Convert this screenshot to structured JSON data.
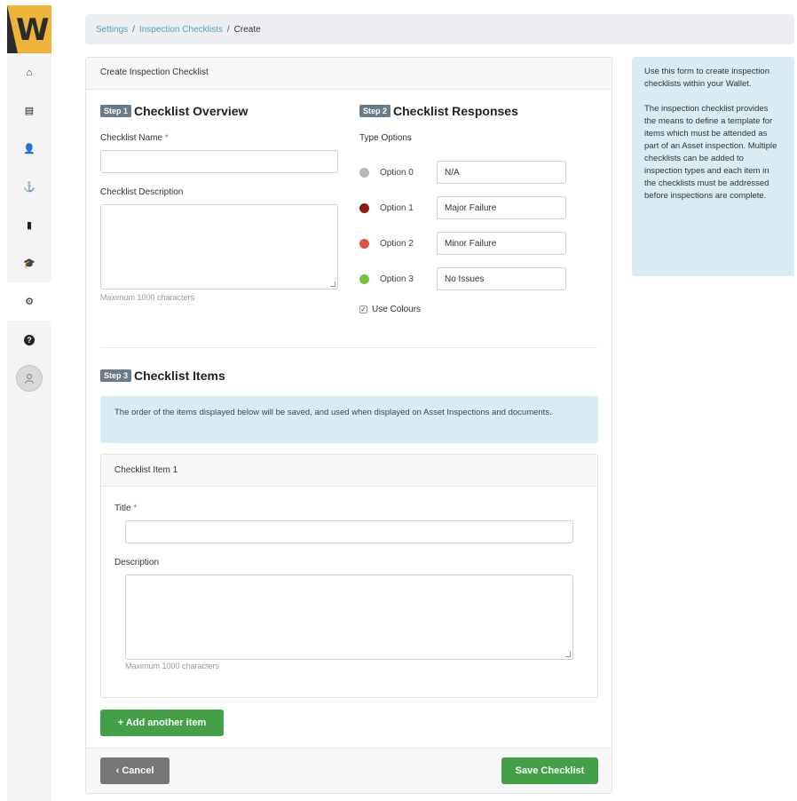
{
  "app": {
    "logo_text": "W"
  },
  "sidebar": {
    "items": [
      {
        "name": "home",
        "icon": "home-icon",
        "glyph": "⌂"
      },
      {
        "name": "documents",
        "icon": "document-icon",
        "glyph": "▤"
      },
      {
        "name": "people",
        "icon": "user-icon",
        "glyph": "👤"
      },
      {
        "name": "assets",
        "icon": "anchor-icon",
        "glyph": "⚓"
      },
      {
        "name": "checklists",
        "icon": "clipboard-icon",
        "glyph": "▮"
      },
      {
        "name": "training",
        "icon": "graduation-cap-icon",
        "glyph": "🎓"
      },
      {
        "name": "settings",
        "icon": "gear-icon",
        "glyph": "⚙"
      },
      {
        "name": "help",
        "icon": "question-icon",
        "glyph": "?"
      }
    ],
    "avatar_icon": "user-avatar-icon"
  },
  "breadcrumb": {
    "items": [
      "Settings",
      "Inspection Checklists"
    ],
    "separator": "/",
    "current": "Create"
  },
  "card": {
    "header": "Create Inspection Checklist",
    "step1": {
      "badge": "Step 1",
      "title": "Checklist Overview",
      "name_label": "Checklist Name",
      "required_marker": "*",
      "name_value": "",
      "description_label": "Checklist Description",
      "description_value": "",
      "description_help": "Maximum 1000 characters"
    },
    "step2": {
      "badge": "Step 2",
      "title": "Checklist Responses",
      "type_options_label": "Type Options",
      "options": [
        {
          "label": "Option 0",
          "value": "N/A",
          "color": "#b8b8b8"
        },
        {
          "label": "Option 1",
          "value": "Major Failure",
          "color": "#8b1a1a"
        },
        {
          "label": "Option 2",
          "value": "Minor Failure",
          "color": "#e0533f"
        },
        {
          "label": "Option 3",
          "value": "No Issues",
          "color": "#7ac143"
        }
      ],
      "use_colours_label": "Use Colours",
      "use_colours_checked": true
    },
    "step3": {
      "badge": "Step 3",
      "title": "Checklist Items",
      "info": "The order of the items displayed below will be saved, and used when displayed on Asset Inspections and documents.",
      "item": {
        "header": "Checklist Item 1",
        "title_label": "Title",
        "required_marker": "*",
        "title_value": "",
        "description_label": "Description",
        "description_value": "",
        "description_help": "Maximum 1000 characters"
      },
      "add_button": "+ Add another item"
    },
    "footer": {
      "cancel_label": "‹ Cancel",
      "save_label": "Save Checklist"
    }
  },
  "side_info": {
    "paragraph1": "Use this form to create inspection checklists within your Wallet.",
    "paragraph2": "The inspection checklist provides the means to define a template for items which must be attended as part of an Asset inspection. Multiple checklists can be added to inspection types and each item in the checklists must be addressed before inspections are complete."
  },
  "colors": {
    "accent_green": "#43a047",
    "info_bg": "#d9ecf3",
    "link": "#5aa0c7",
    "logo": "#f0b33a"
  }
}
